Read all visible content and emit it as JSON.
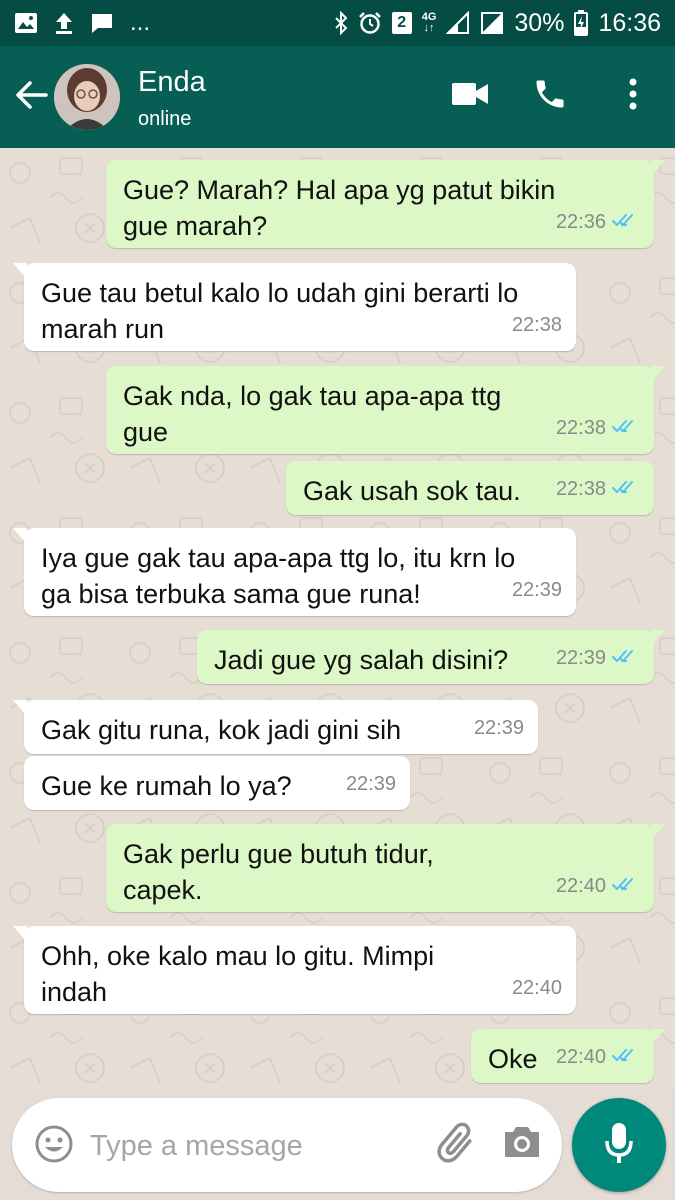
{
  "status_bar": {
    "notifications": [
      "image-icon",
      "upload-icon",
      "message-icon"
    ],
    "overflow": "...",
    "sim_badge": "2",
    "network": "4G",
    "battery": "30%",
    "time": "16:36"
  },
  "header": {
    "contact_name": "Enda",
    "contact_status": "online"
  },
  "messages": [
    {
      "dir": "out",
      "text": "Gue? Marah? Hal apa yg patut bikin\ngue marah?",
      "time": "22:36",
      "read": true
    },
    {
      "dir": "in",
      "text": "Gue tau betul kalo lo udah gini berarti lo\nmarah run",
      "time": "22:38"
    },
    {
      "dir": "out",
      "text": "Gak nda, lo gak tau apa-apa ttg\ngue",
      "time": "22:38",
      "read": true
    },
    {
      "dir": "out",
      "text": "Gak usah sok tau.",
      "time": "22:38",
      "read": true
    },
    {
      "dir": "in",
      "text": "Iya gue gak tau apa-apa ttg lo, itu krn lo\nga bisa terbuka sama gue runa!",
      "time": "22:39"
    },
    {
      "dir": "out",
      "text": "Jadi gue yg salah disini?",
      "time": "22:39",
      "read": true
    },
    {
      "dir": "in",
      "text": "Gak gitu runa, kok jadi gini sih",
      "time": "22:39"
    },
    {
      "dir": "in",
      "text": "Gue ke rumah lo ya?",
      "time": "22:39"
    },
    {
      "dir": "out",
      "text": "Gak perlu gue butuh tidur,\ncapek.",
      "time": "22:40",
      "read": true
    },
    {
      "dir": "in",
      "text": "Ohh, oke kalo mau lo gitu. Mimpi\nindah",
      "time": "22:40"
    },
    {
      "dir": "out",
      "text": "Oke",
      "time": "22:40",
      "read": true
    }
  ],
  "composer": {
    "placeholder": "Type a message"
  },
  "colors": {
    "header": "#075e54",
    "status_bar": "#054d44",
    "outgoing_bubble": "#dcf8c6",
    "incoming_bubble": "#ffffff",
    "read_ticks": "#4fc3f7",
    "mic_button": "#00897b"
  }
}
